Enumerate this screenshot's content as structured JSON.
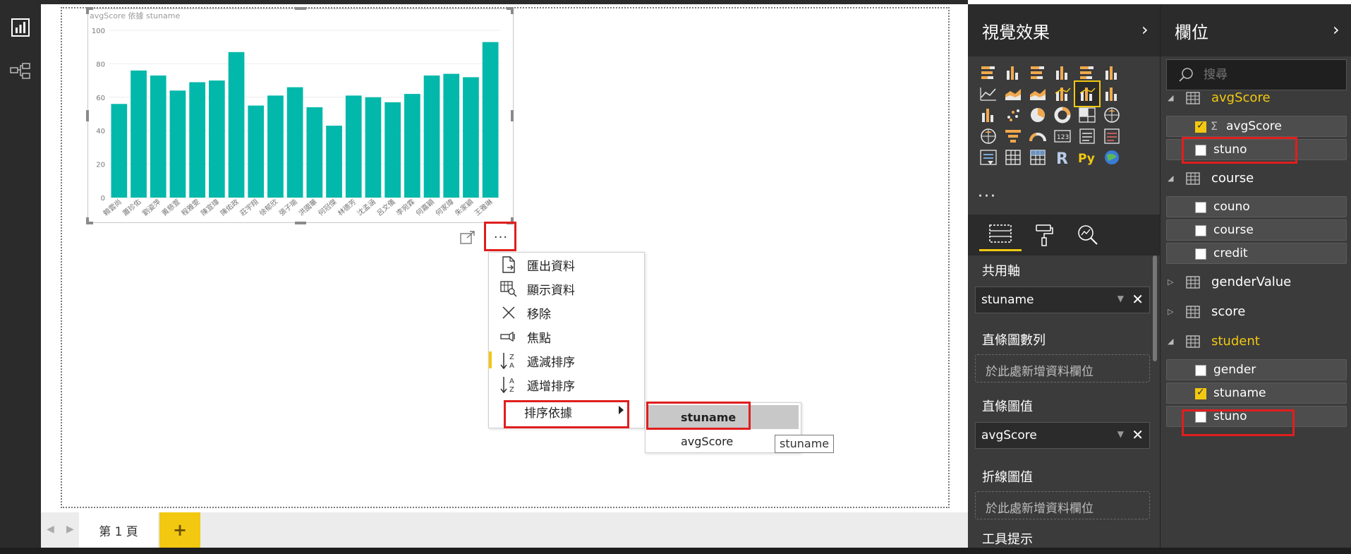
{
  "colors": {
    "accent_yellow": "#f2c811",
    "bar_teal": "#01b8aa",
    "highlight_red": "#e01e1e",
    "pane_dark": "#3b3b3b"
  },
  "left_nav": {
    "report_view_icon": "bar-chart-icon",
    "relationship_view_icon": "model-icon"
  },
  "chart": {
    "title": "avgScore 依據 stuname",
    "focus_icon": "focus-mode-icon",
    "more_options_label": "···"
  },
  "chart_data": {
    "type": "bar",
    "title": "avgScore 依據 stuname",
    "categories": [
      "賴雲尚",
      "蕭珍佑",
      "劉姿萍",
      "黃慈萱",
      "程雅雯",
      "陳宣瑋",
      "陳佑政",
      "莊宇翔",
      "徐郁欣",
      "張子瑜",
      "洪國華",
      "何冠傑",
      "林德芳",
      "沈孟涵",
      "呂文儀",
      "李宛霖",
      "何嘉穎",
      "何家瑋",
      "朱家穎",
      "王雅琳"
    ],
    "values": [
      56,
      76,
      73,
      64,
      69,
      70,
      87,
      55,
      61,
      66,
      54,
      43,
      61,
      60,
      57,
      62,
      73,
      74,
      72,
      93
    ],
    "ylim": [
      0,
      100
    ],
    "yticks": [
      0,
      20,
      40,
      60,
      80,
      100
    ],
    "grid": true,
    "xlabel": "",
    "ylabel": ""
  },
  "context_menu": {
    "items": [
      {
        "label": "匯出資料",
        "icon": "export-data-icon"
      },
      {
        "label": "顯示資料",
        "icon": "show-data-icon"
      },
      {
        "label": "移除",
        "icon": "remove-icon"
      },
      {
        "label": "焦點",
        "icon": "spotlight-icon"
      },
      {
        "label": "遞減排序",
        "icon": "sort-descending-icon"
      },
      {
        "label": "遞增排序",
        "icon": "sort-ascending-icon"
      },
      {
        "label": "排序依據",
        "icon": "submenu-arrow-icon"
      }
    ],
    "submenu": [
      "stuname",
      "avgScore"
    ],
    "tooltip": "stuname"
  },
  "page_tabs": {
    "current": "第 1 頁",
    "add_label": "+"
  },
  "viz_pane": {
    "title": "視覺效果",
    "more": "···",
    "wells": {
      "shared_axis_label": "共用軸",
      "shared_axis_value": "stuname",
      "column_series_label": "直條圖數列",
      "column_series_placeholder": "於此處新增資料欄位",
      "column_values_label": "直條圖值",
      "column_values_value": "avgScore",
      "line_values_label": "折線圖值",
      "line_values_placeholder": "於此處新增資料欄位",
      "tooltips_label": "工具提示"
    }
  },
  "fields_pane": {
    "title": "欄位",
    "search_placeholder": "搜尋",
    "tables": [
      {
        "name": "avgScore",
        "expanded": true,
        "active": true,
        "fields": [
          {
            "name": "avgScore",
            "checked": true,
            "sigma": true
          },
          {
            "name": "stuno",
            "checked": false
          }
        ]
      },
      {
        "name": "course",
        "expanded": true,
        "active": false,
        "fields": [
          {
            "name": "couno",
            "checked": false
          },
          {
            "name": "course",
            "checked": false
          },
          {
            "name": "credit",
            "checked": false
          }
        ]
      },
      {
        "name": "genderValue",
        "expanded": false,
        "active": false,
        "fields": []
      },
      {
        "name": "score",
        "expanded": false,
        "active": false,
        "fields": []
      },
      {
        "name": "student",
        "expanded": true,
        "active": true,
        "fields": [
          {
            "name": "gender",
            "checked": false
          },
          {
            "name": "stuname",
            "checked": true
          },
          {
            "name": "stuno",
            "checked": false
          }
        ]
      }
    ]
  }
}
